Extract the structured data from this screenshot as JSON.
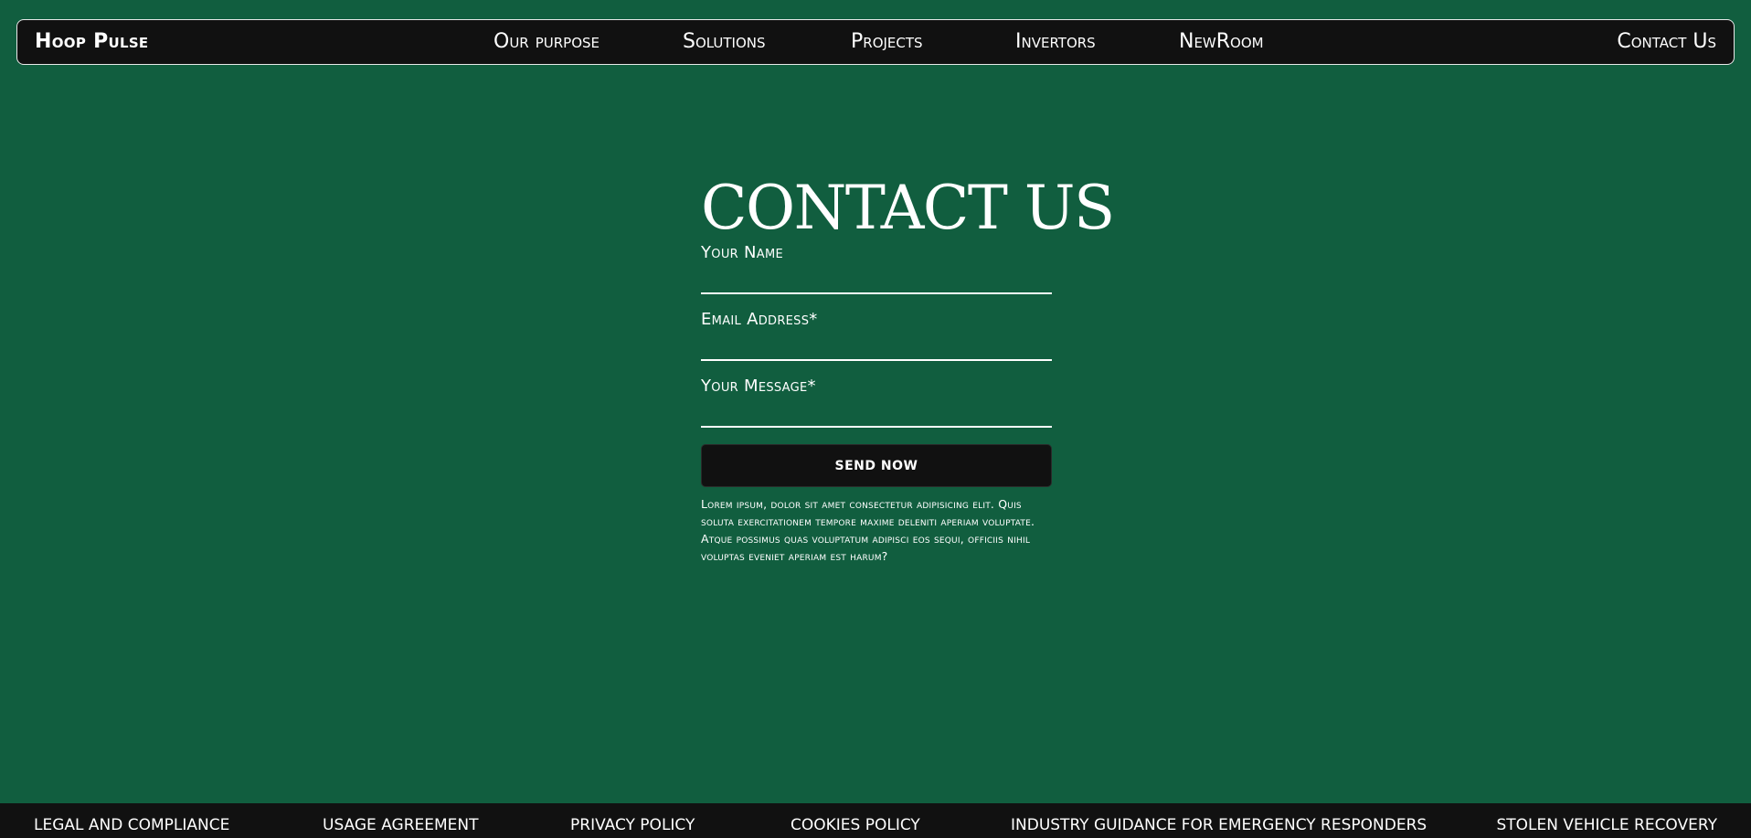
{
  "header": {
    "brand": "Hoop Pulse",
    "nav": [
      "Our purpose",
      "Solutions",
      "Projects",
      "Invertors",
      "NewRoom"
    ],
    "contact_link": "Contact Us"
  },
  "main": {
    "title": "CONTACT US",
    "fields": [
      {
        "label": "Your Name",
        "value": "",
        "placeholder": ""
      },
      {
        "label": "Email Address*",
        "value": "",
        "placeholder": ""
      },
      {
        "label": "Your Message*",
        "value": "",
        "placeholder": ""
      }
    ],
    "submit_label": "SEND NOW",
    "note": "Lorem ipsum, dolor sit amet consectetur adipisicing elit. Quis soluta exercitationem tempore maxime deleniti aperiam voluptate. Atque possimus quas voluptatum adipisci eos sequi, officiis nihil voluptas eveniet aperiam est harum?"
  },
  "footer": {
    "links": [
      "LEGAL AND COMPLIANCE",
      "USAGE AGREEMENT",
      "PRIVACY POLICY",
      "COOKIES POLICY",
      "INDUSTRY GUIDANCE FOR EMERGENCY RESPONDERS",
      "STOLEN VEHICLE RECOVERY"
    ]
  },
  "colors": {
    "background": "#115e3f",
    "bar": "#111111",
    "text": "#ffffff"
  }
}
